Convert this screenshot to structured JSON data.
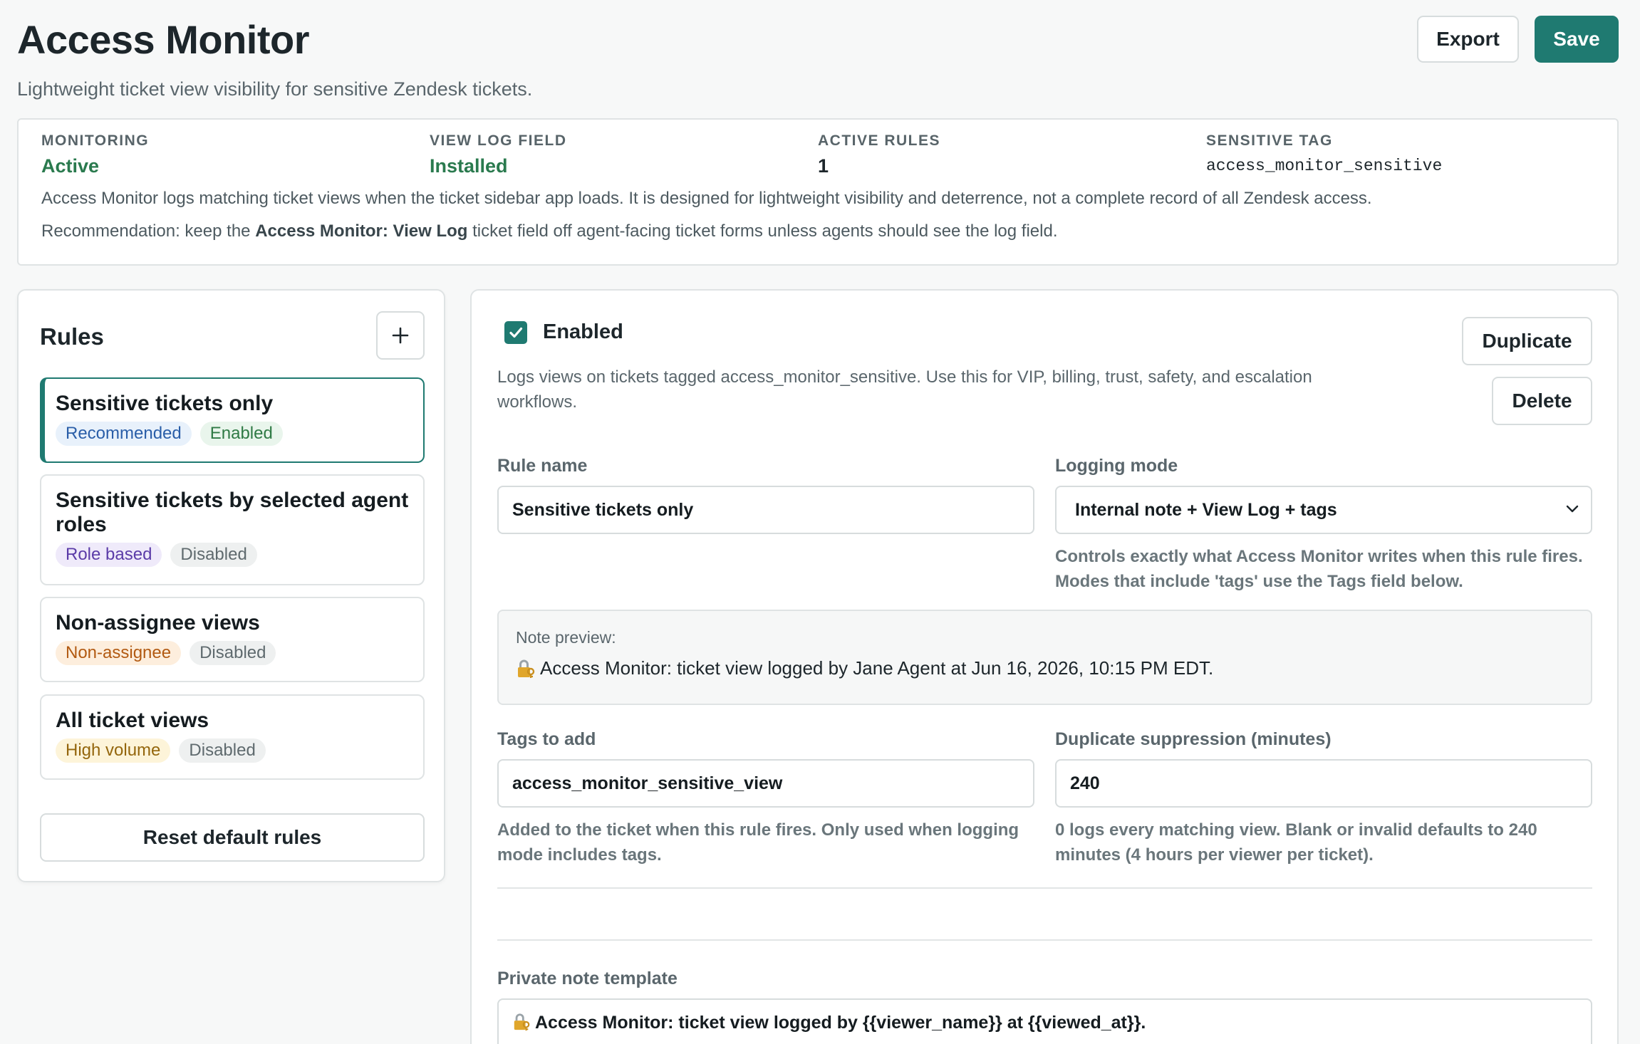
{
  "header": {
    "title": "Access Monitor",
    "subtitle": "Lightweight ticket view visibility for sensitive Zendesk tickets.",
    "export_label": "Export",
    "save_label": "Save"
  },
  "summary": {
    "stats": [
      {
        "label": "MONITORING",
        "value": "Active"
      },
      {
        "label": "VIEW LOG FIELD",
        "value": "Installed"
      },
      {
        "label": "ACTIVE RULES",
        "value": "1"
      },
      {
        "label": "SENSITIVE TAG",
        "value": "access_monitor_sensitive"
      }
    ],
    "description": "Access Monitor logs matching ticket views when the ticket sidebar app loads. It is designed for lightweight visibility and deterrence, not a complete record of all Zendesk access.",
    "recommendation_prefix": "Recommendation: keep the ",
    "recommendation_field": "Access Monitor: View Log",
    "recommendation_suffix": " ticket field off agent-facing ticket forms unless agents should see the log field.",
    "colors": {
      "active": "#2a7a4e",
      "accent": "#1f7a71"
    }
  },
  "rules": {
    "title": "Rules",
    "add_icon": "plus-icon",
    "items": [
      {
        "name": "Sensitive tickets only",
        "badges": [
          "Recommended",
          "Enabled"
        ]
      },
      {
        "name": "Sensitive tickets by selected agent roles",
        "badges": [
          "Role based",
          "Disabled"
        ]
      },
      {
        "name": "Non-assignee views",
        "badges": [
          "Non-assignee",
          "Disabled"
        ]
      },
      {
        "name": "All ticket views",
        "badges": [
          "High volume",
          "Disabled"
        ]
      }
    ],
    "reset_label": "Reset default rules"
  },
  "detail": {
    "enabled_label": "Enabled",
    "enabled_checked": true,
    "description": "Logs views on tickets tagged access_monitor_sensitive. Use this for VIP, billing, trust, safety, and escalation workflows.",
    "duplicate_label": "Duplicate",
    "delete_label": "Delete",
    "rule_name_label": "Rule name",
    "rule_name_value": "Sensitive tickets only",
    "logging_mode_label": "Logging mode",
    "logging_mode_value": "Internal note + View Log + tags",
    "logging_mode_help": "Controls exactly what Access Monitor writes when this rule fires. Modes that include 'tags' use the Tags field below.",
    "preview_label": "Note preview:",
    "preview_text": "Access Monitor: ticket view logged by Jane Agent at Jun 16, 2026, 10:15 PM EDT.",
    "tags_label": "Tags to add",
    "tags_value": "access_monitor_sensitive_view",
    "tags_help": "Added to the ticket when this rule fires. Only used when logging mode includes tags.",
    "suppression_label": "Duplicate suppression (minutes)",
    "suppression_value": "240",
    "suppression_help": "0 logs every matching view. Blank or invalid defaults to 240 minutes (4 hours per viewer per ticket).",
    "template_label": "Private note template",
    "template_value": "Access Monitor: ticket view logged by {{viewer_name}} at {{viewed_at}}."
  }
}
